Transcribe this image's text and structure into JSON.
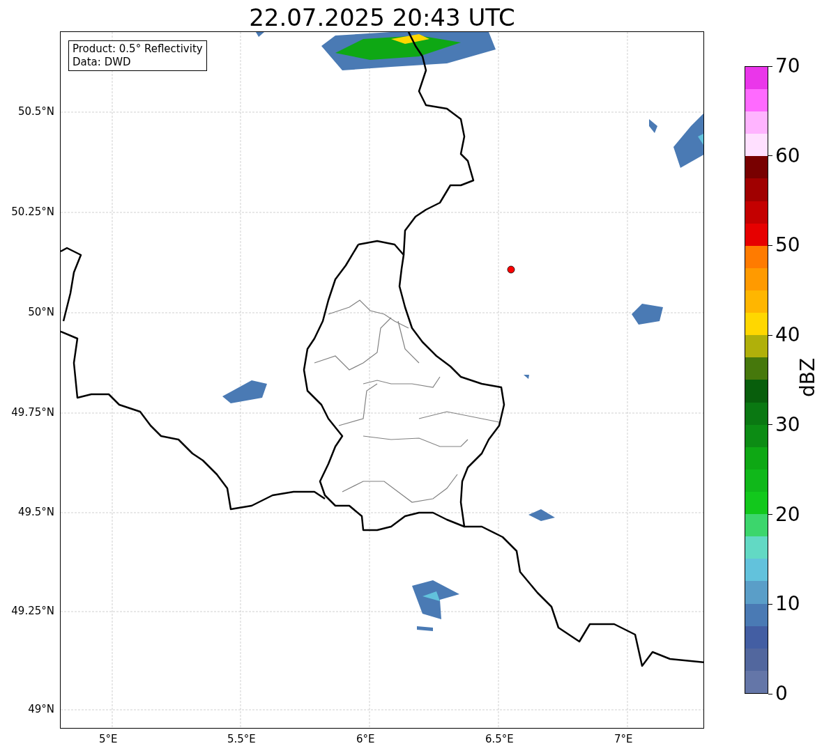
{
  "title": "22.07.2025 20:43 UTC",
  "info_box": {
    "lines": [
      "Product: 0.5° Reflectivity",
      "Data: DWD"
    ]
  },
  "map": {
    "xticks": [
      "5°E",
      "5.5°E",
      "6°E",
      "6.5°E",
      "7°E"
    ],
    "yticks": [
      "50.5°N",
      "50.25°N",
      "50°N",
      "49.75°N",
      "49.5°N",
      "49.25°N",
      "49°N"
    ]
  },
  "colorbar": {
    "label": "dBZ",
    "ticks": [
      "70",
      "60",
      "50",
      "40",
      "30",
      "20",
      "10",
      "0"
    ],
    "bins": [
      {
        "color": "#6476a8"
      },
      {
        "color": "#52679e"
      },
      {
        "color": "#435ea3"
      },
      {
        "color": "#4a7ab4"
      },
      {
        "color": "#5a9ec8"
      },
      {
        "color": "#62c2dc"
      },
      {
        "color": "#62d9c4"
      },
      {
        "color": "#3cd66c"
      },
      {
        "color": "#12c81c"
      },
      {
        "color": "#10b81a"
      },
      {
        "color": "#0ea814"
      },
      {
        "color": "#0c8c14"
      },
      {
        "color": "#0a7812"
      },
      {
        "color": "#085e0c"
      },
      {
        "color": "#46780c"
      },
      {
        "color": "#b0b00a"
      },
      {
        "color": "#ffd700"
      },
      {
        "color": "#ffb600"
      },
      {
        "color": "#ff9a00"
      },
      {
        "color": "#ff7b00"
      },
      {
        "color": "#e60000"
      },
      {
        "color": "#c40000"
      },
      {
        "color": "#a00000"
      },
      {
        "color": "#780000"
      },
      {
        "color": "#ffe0ff"
      },
      {
        "color": "#ffb4ff"
      },
      {
        "color": "#ff6aff"
      },
      {
        "color": "#ea36ea"
      }
    ]
  }
}
